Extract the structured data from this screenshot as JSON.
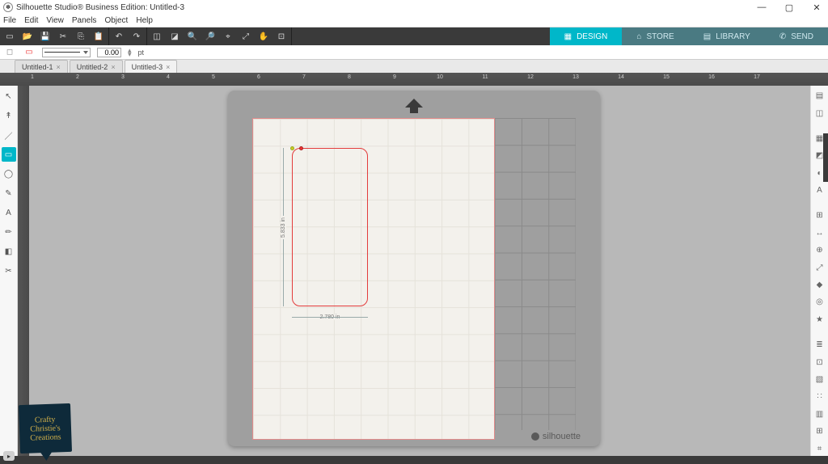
{
  "window": {
    "title": "Silhouette Studio® Business Edition: Untitled-3",
    "buttons": {
      "min": "—",
      "max": "▢",
      "close": "✕"
    }
  },
  "menu": [
    "File",
    "Edit",
    "View",
    "Panels",
    "Object",
    "Help"
  ],
  "toolbar": {
    "stroke_weight": "0.00",
    "unit": "pt"
  },
  "nav": [
    {
      "icon": "▦",
      "label": "DESIGN",
      "active": true
    },
    {
      "icon": "⌂",
      "label": "STORE",
      "active": false
    },
    {
      "icon": "▤",
      "label": "LIBRARY",
      "active": false
    },
    {
      "icon": "✆",
      "label": "SEND",
      "active": false
    }
  ],
  "tabs": [
    {
      "label": "Untitled-1",
      "active": false
    },
    {
      "label": "Untitled-2",
      "active": false
    },
    {
      "label": "Untitled-3",
      "active": true
    }
  ],
  "ruler_labels": [
    "1",
    "2",
    "3",
    "4",
    "5",
    "6",
    "7",
    "8",
    "9",
    "10",
    "11",
    "12",
    "13",
    "14",
    "15",
    "16",
    "17"
  ],
  "left_tools": [
    {
      "name": "select-tool",
      "glyph": "↖",
      "active": false
    },
    {
      "name": "edit-points-tool",
      "glyph": "↟",
      "active": false
    },
    {
      "name": "line-tool",
      "glyph": "／",
      "active": false
    },
    {
      "name": "rectangle-tool",
      "glyph": "▭",
      "active": true
    },
    {
      "name": "ellipse-tool",
      "glyph": "◯",
      "active": false
    },
    {
      "name": "freehand-tool",
      "glyph": "✎",
      "active": false
    },
    {
      "name": "text-tool",
      "glyph": "A",
      "active": false
    },
    {
      "name": "draw-note-tool",
      "glyph": "✏",
      "active": false
    },
    {
      "name": "eraser-tool",
      "glyph": "◧",
      "active": false
    },
    {
      "name": "knife-tool",
      "glyph": "✂",
      "active": false
    }
  ],
  "right_tools": [
    {
      "name": "page-setup-icon",
      "glyph": "▤"
    },
    {
      "name": "pixscan-icon",
      "glyph": "◫"
    },
    {
      "name": "fill-color-icon",
      "glyph": "▦"
    },
    {
      "name": "line-color-icon",
      "glyph": "◩"
    },
    {
      "name": "gradient-icon",
      "glyph": "◐"
    },
    {
      "name": "text-style-icon",
      "glyph": "A"
    },
    {
      "name": "image-effects-icon",
      "glyph": "⊞"
    },
    {
      "name": "transform-icon",
      "glyph": "↔"
    },
    {
      "name": "replicate-icon",
      "glyph": "⊕"
    },
    {
      "name": "scale-icon",
      "glyph": "⤢"
    },
    {
      "name": "modify-icon",
      "glyph": "◆"
    },
    {
      "name": "offset-icon",
      "glyph": "◎"
    },
    {
      "name": "trace-icon",
      "glyph": "★"
    },
    {
      "name": "layers-icon",
      "glyph": "≣"
    },
    {
      "name": "nesting-icon",
      "glyph": "⊡"
    },
    {
      "name": "emboss-icon",
      "glyph": "▧"
    },
    {
      "name": "stipple-icon",
      "glyph": "∷"
    },
    {
      "name": "media-layout-icon",
      "glyph": "▥"
    },
    {
      "name": "tiling-icon",
      "glyph": "⊞"
    },
    {
      "name": "weed-icon",
      "glyph": "⌗"
    }
  ],
  "shape": {
    "width_label": "2.780 in",
    "height_label": "5.833 in"
  },
  "brand": "silhouette",
  "watermark": "Crafty Christie's Creations"
}
